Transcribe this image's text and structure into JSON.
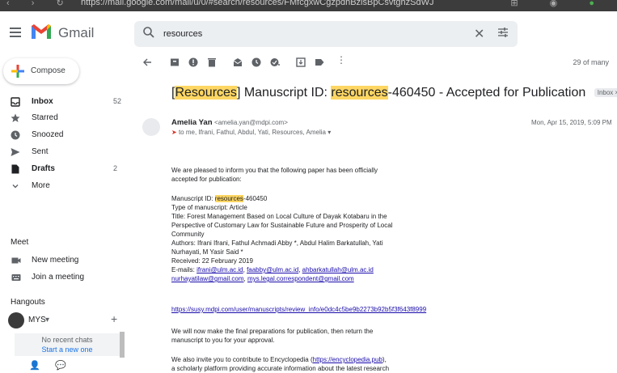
{
  "browser": {
    "url": "https://mail.google.com/mail/u/0/#search/resources/FMfcgxwCgzpdhBzlsBpCsvtghzSdWJ"
  },
  "header": {
    "app_name": "Gmail",
    "search_value": "resources"
  },
  "sidebar": {
    "compose_label": "Compose",
    "items": [
      {
        "label": "Inbox",
        "count": "52",
        "bold": true
      },
      {
        "label": "Starred",
        "count": ""
      },
      {
        "label": "Snoozed",
        "count": ""
      },
      {
        "label": "Sent",
        "count": ""
      },
      {
        "label": "Drafts",
        "count": "2",
        "bold": true
      },
      {
        "label": "More",
        "count": ""
      }
    ],
    "meet_title": "Meet",
    "meet_items": [
      {
        "label": "New meeting"
      },
      {
        "label": "Join a meeting"
      }
    ],
    "hangouts_title": "Hangouts",
    "hangouts_user": "MYS",
    "no_recent_chats": "No recent chats",
    "start_new": "Start a new one"
  },
  "toolbar": {
    "page_count": "29 of many"
  },
  "email": {
    "subject_pre": "[",
    "subject_hl1": "Resources",
    "subject_mid": "] Manuscript ID: ",
    "subject_hl2": "resources",
    "subject_post": "-460450 - Accepted for Publication",
    "label_badge": "Inbox ×",
    "sender_name": "Amelia Yan",
    "sender_email": "<amelia.yan@mdpi.com>",
    "recipients": "to me, Ifrani, Fathul, Abdul, Yati, Resources, Amelia",
    "date": "Mon, Apr 15, 2019, 5:09 PM",
    "intro_1": "We are pleased to inform you that the following paper has been officially",
    "intro_2": "accepted for publication:",
    "ms_id_label": "Manuscript ID: ",
    "ms_id_hl": "resources",
    "ms_id_rest": "-460450",
    "type": "Type of manuscript: Article",
    "title_1": "Title: Forest Management Based on Local Culture of Dayak Kotabaru in the",
    "title_2": "Perspective of Customary Law for Sustainable Future and Prosperity of Local",
    "title_3": "Community",
    "authors_1": "Authors: Ifrani Ifrani, Fathul Achmadi Abby *, Abdul Halim Barkatullah, Yati",
    "authors_2": "Nurhayati, M Yasir Said *",
    "received": "Received: 22 February 2019",
    "emails_label": "E-mails: ",
    "email_1": "ifrani@ulm.ac.id",
    "email_2": "faabby@ulm.ac.id",
    "email_3": "ahbarkatullah@ulm.ac.id",
    "email_4": "nurhayatilaw@gmail.com",
    "email_5": "mys.legal.correspondent@gmail.com",
    "review_link": "https://susy.mdpi.com/user/manuscripts/review_info/e0dc4c5be9b2273b92b5f3f643f8999",
    "final_1": "We will now make the final preparations for publication, then return the",
    "final_2": "manuscript to you for your approval.",
    "invite_pre": "We also invite you to contribute to Encyclopedia (",
    "invite_link": "https://encyclopedia.pub",
    "invite_post": "),",
    "invite_2": "a scholarly platform providing accurate information about the latest research"
  }
}
